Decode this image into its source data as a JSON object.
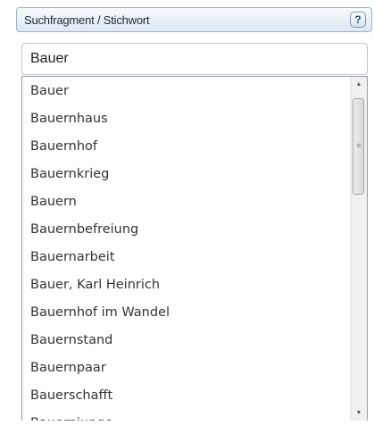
{
  "header": {
    "label": "Suchfragment / Stichwort",
    "help_glyph": "?"
  },
  "search": {
    "value": "Bauer"
  },
  "suggestions": [
    "Bauer",
    "Bauernhaus",
    "Bauernhof",
    "Bauernkrieg",
    "Bauern",
    "Bauernbefreiung",
    "Bauernarbeit",
    "Bauer, Karl Heinrich",
    "Bauernhof im Wandel",
    "Bauernstand",
    "Bauernpaar",
    "Bauerschafft",
    "Bauernjunge"
  ],
  "icons": {
    "help": "help-icon",
    "scroll_up": "scroll-up-arrow-icon",
    "scroll_down": "scroll-down-arrow-icon",
    "grip": "scrollbar-grip-icon"
  },
  "colors": {
    "header_border": "#9fb3c8",
    "text": "#333333"
  }
}
